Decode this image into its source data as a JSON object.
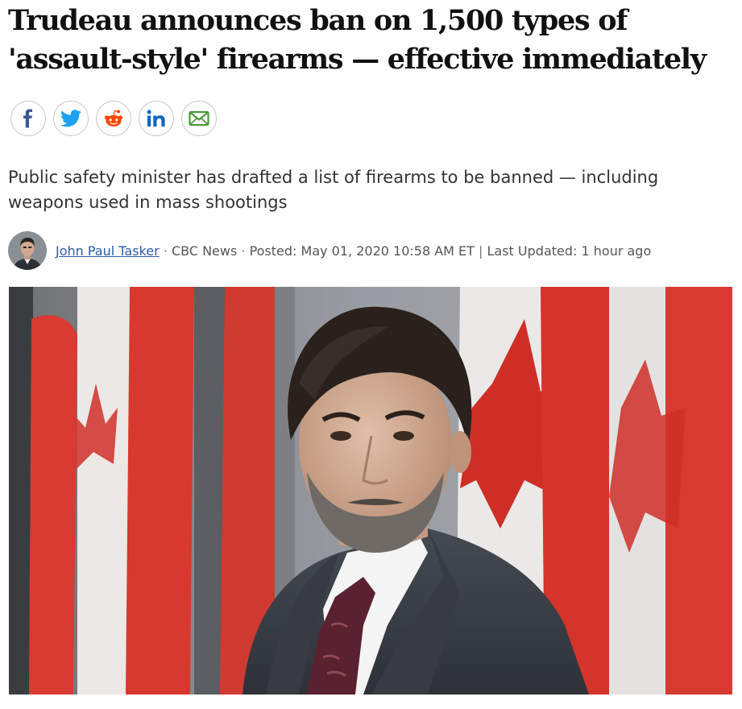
{
  "article": {
    "headline": "Trudeau announces ban on 1,500 types of 'assault-style' firearms — effective immediately",
    "dek": "Public safety minister has drafted a list of firearms to be banned — including weapons used in mass shootings"
  },
  "share": [
    {
      "name": "facebook",
      "icon": "facebook-icon",
      "color": "#3b5998"
    },
    {
      "name": "twitter",
      "icon": "twitter-icon",
      "color": "#1da1f2"
    },
    {
      "name": "reddit",
      "icon": "reddit-icon",
      "color": "#ff4500"
    },
    {
      "name": "linkedin",
      "icon": "linkedin-icon",
      "color": "#0a66c2"
    },
    {
      "name": "email",
      "icon": "email-icon",
      "color": "#4c9a3d"
    }
  ],
  "byline": {
    "author": "John Paul Tasker",
    "separator1": " · ",
    "outlet": "CBC News",
    "separator2": " · ",
    "posted": "Posted: May 01, 2020 10:58 AM ET",
    "divider": " | ",
    "updated": "Last Updated: 1 hour ago"
  },
  "image": {
    "subject": "man in dark suit in front of Canadian flags"
  }
}
